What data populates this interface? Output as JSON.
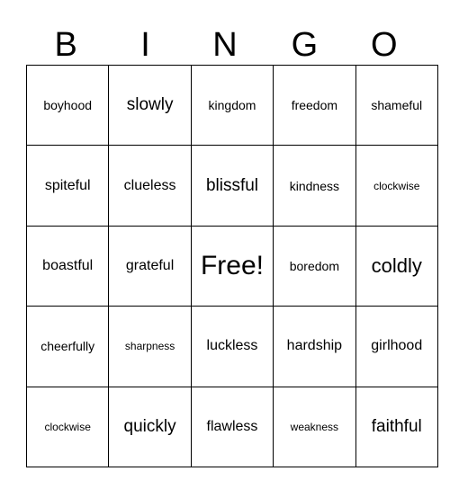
{
  "card": {
    "headers": [
      "B",
      "I",
      "N",
      "G",
      "O"
    ],
    "rows": [
      [
        {
          "text": "boyhood",
          "size": "s"
        },
        {
          "text": "slowly",
          "size": "l"
        },
        {
          "text": "kingdom",
          "size": "s"
        },
        {
          "text": "freedom",
          "size": "s"
        },
        {
          "text": "shameful",
          "size": "s"
        }
      ],
      [
        {
          "text": "spiteful",
          "size": "m"
        },
        {
          "text": "clueless",
          "size": "m"
        },
        {
          "text": "blissful",
          "size": "l"
        },
        {
          "text": "kindness",
          "size": "s"
        },
        {
          "text": "clockwise",
          "size": "xs"
        }
      ],
      [
        {
          "text": "boastful",
          "size": "m"
        },
        {
          "text": "grateful",
          "size": "m"
        },
        {
          "text": "Free!",
          "size": "xxl"
        },
        {
          "text": "boredom",
          "size": "s"
        },
        {
          "text": "coldly",
          "size": "xl"
        }
      ],
      [
        {
          "text": "cheerfully",
          "size": "s"
        },
        {
          "text": "sharpness",
          "size": "xs"
        },
        {
          "text": "luckless",
          "size": "m"
        },
        {
          "text": "hardship",
          "size": "m"
        },
        {
          "text": "girlhood",
          "size": "m"
        }
      ],
      [
        {
          "text": "clockwise",
          "size": "xs"
        },
        {
          "text": "quickly",
          "size": "l"
        },
        {
          "text": "flawless",
          "size": "m"
        },
        {
          "text": "weakness",
          "size": "xs"
        },
        {
          "text": "faithful",
          "size": "l"
        }
      ]
    ]
  },
  "colors": {
    "background": "#ffffff",
    "text": "#000000",
    "border": "#000000"
  }
}
